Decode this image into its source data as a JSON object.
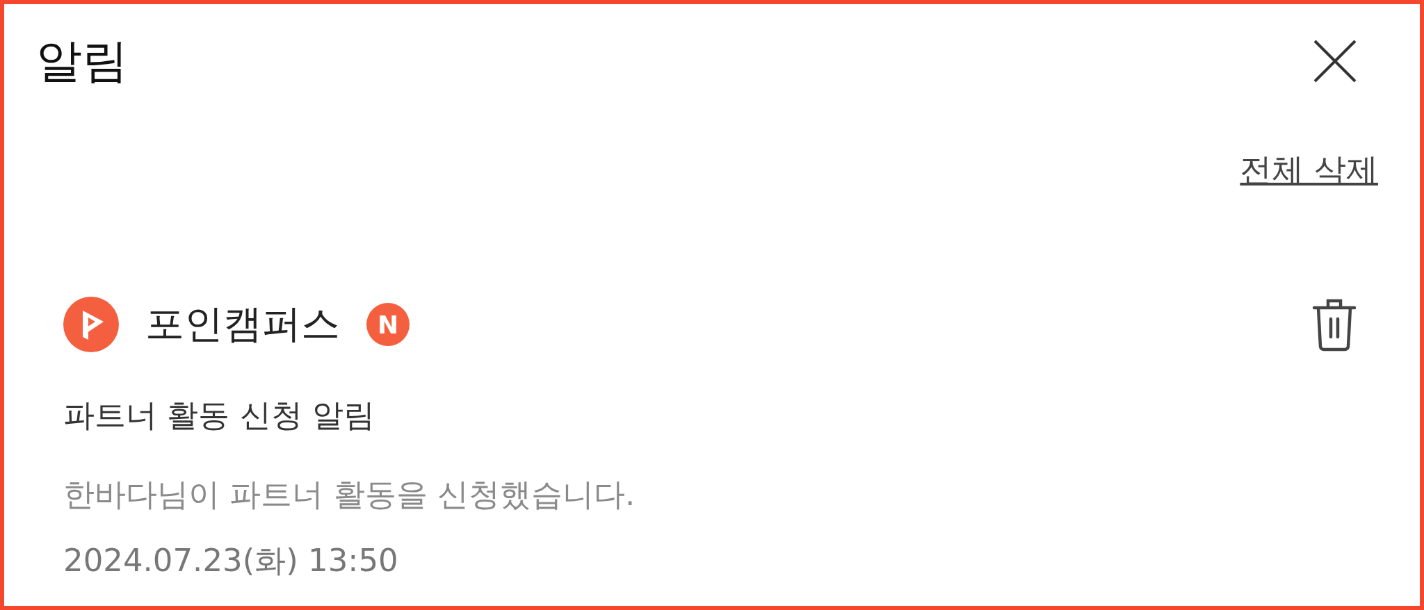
{
  "header": {
    "title": "알림"
  },
  "actions": {
    "delete_all": "전체 삭제"
  },
  "notifications": [
    {
      "source": "포인캠퍼스",
      "badge": "N",
      "unread": true,
      "title": "파트너 활동 신청 알림",
      "message": "한바다님이 파트너 활동을 신청했습니다.",
      "time": "2024.07.23(화) 13:50"
    }
  ]
}
